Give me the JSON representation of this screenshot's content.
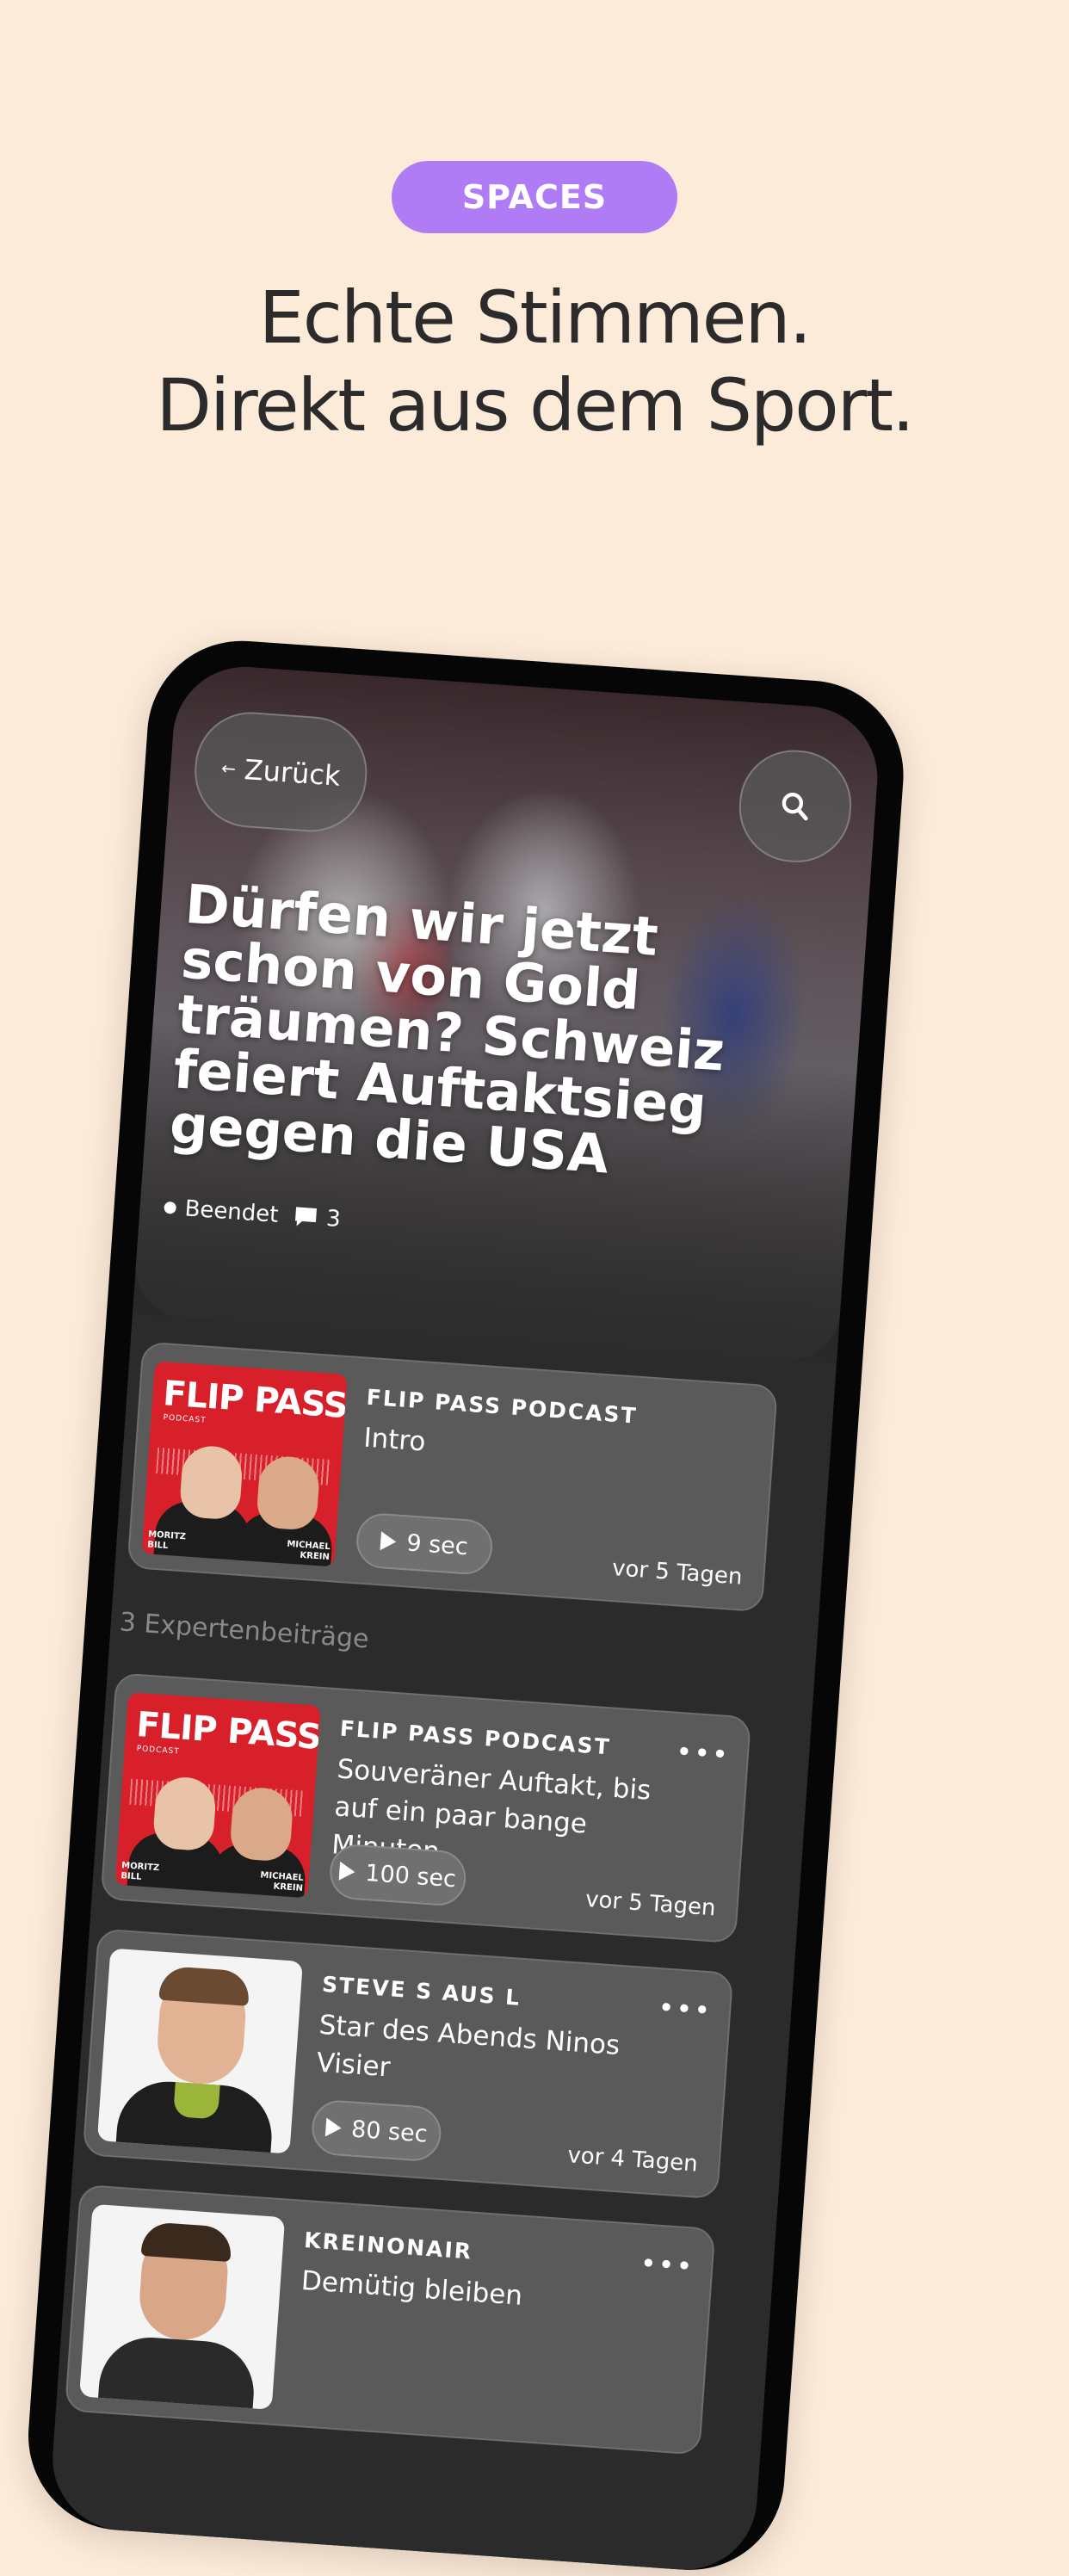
{
  "badge": "SPACES",
  "headline": {
    "line1": "Echte Stimmen.",
    "line2": "Direkt aus dem Sport."
  },
  "app": {
    "back_label": "Zurück",
    "hero_title": "Dürfen wir jetzt schon von Gold träumen? Schweiz feiert Auftaktsieg gegen die USA",
    "status": "Beendet",
    "comment_count": "3",
    "intro_card": {
      "cover": {
        "title": "FLIP PASS",
        "sub": "PODCAST",
        "name_left": "MORITZ\nBILL",
        "name_right": "MICHAEL\nKREIN"
      },
      "source": "FLIP PASS PODCAST",
      "title": "Intro",
      "duration": "9 sec",
      "ago": "vor 5 Tagen"
    },
    "section_label": "3 Expertenbeiträge",
    "posts": [
      {
        "cover": {
          "title": "FLIP PASS",
          "sub": "PODCAST",
          "name_left": "MORITZ\nBILL",
          "name_right": "MICHAEL\nKREIN"
        },
        "source": "FLIP PASS PODCAST",
        "title": "Souveräner Auftakt, bis auf ein paar bange Minuten",
        "duration": "100 sec",
        "ago": "vor 5 Tagen",
        "more": "•••"
      },
      {
        "source": "STEVE S AUS L",
        "title": "Star des Abends Ninos Visier",
        "duration": "80 sec",
        "ago": "vor 4 Tagen",
        "more": "•••"
      },
      {
        "source": "KREINONAIR",
        "title": "Demütig bleiben",
        "more": "•••"
      }
    ]
  },
  "icons": {
    "back": "arrow-left-icon",
    "search": "search-icon",
    "comment": "comment-icon",
    "play": "play-icon",
    "more": "more-icon"
  },
  "colors": {
    "background": "#fdebd9",
    "badge": "#b07cf5",
    "headline": "#2b2b2b",
    "phone": "#060606",
    "screen": "#2b2b2b",
    "card": "#5a5a5a",
    "flip_pass_red": "#d8202a"
  }
}
